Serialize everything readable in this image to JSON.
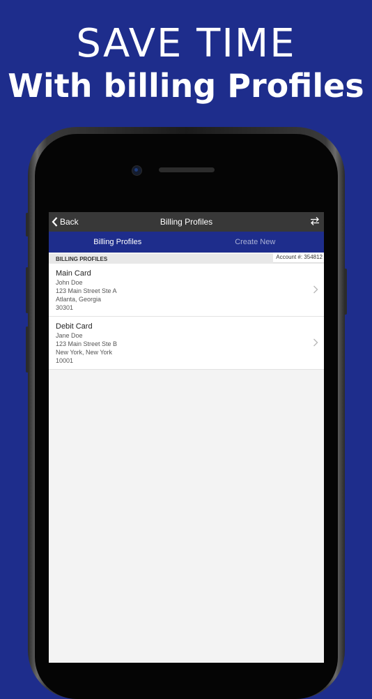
{
  "hero": {
    "line1": "SAVE TIME",
    "line2": "With billing Profiles"
  },
  "navbar": {
    "back_label": "Back",
    "title": "Billing Profiles",
    "swap_icon": "swap-arrows-icon"
  },
  "tabs": [
    {
      "label": "Billing Profiles",
      "active": true
    },
    {
      "label": "Create New",
      "active": false
    }
  ],
  "account": {
    "label": "Account #: 354812"
  },
  "section": {
    "label": "BILLING PROFILES"
  },
  "profiles": [
    {
      "title": "Main Card",
      "name": "John Doe",
      "street": "123 Main Street Ste A",
      "city_state": "Atlanta, Georgia",
      "zip": "30301"
    },
    {
      "title": "Debit Card",
      "name": "Jane Doe",
      "street": "123 Main Street Ste B",
      "city_state": "New York, New York",
      "zip": "10001"
    }
  ],
  "colors": {
    "brand_blue": "#1e2d8c",
    "navbar": "#383838"
  }
}
